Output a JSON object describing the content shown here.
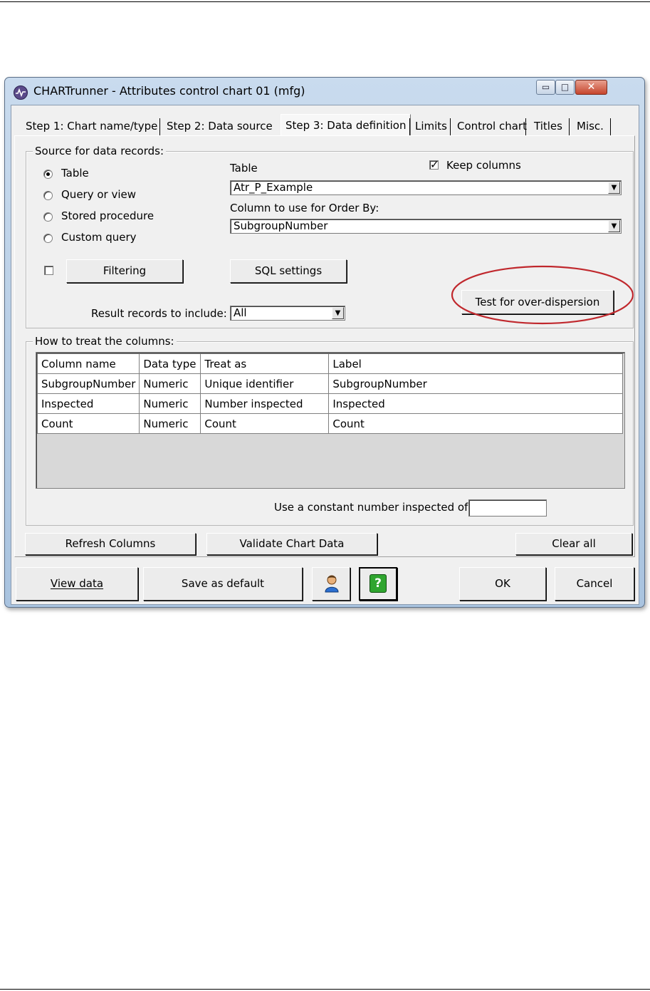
{
  "window": {
    "title": "CHARTrunner - Attributes control chart 01 (mfg)",
    "controls": {
      "minimize": "▭",
      "maximize": "□",
      "close": "✕"
    }
  },
  "tabs": [
    {
      "label": "Step 1: Chart name/type"
    },
    {
      "label": "Step 2: Data source"
    },
    {
      "label": "Step 3: Data definition",
      "active": true
    },
    {
      "label": "Limits"
    },
    {
      "label": "Control chart"
    },
    {
      "label": "Titles"
    },
    {
      "label": "Misc."
    }
  ],
  "source": {
    "group_label": "Source for data records:",
    "options": [
      {
        "label": "Table",
        "selected": true
      },
      {
        "label": "Query or view",
        "selected": false
      },
      {
        "label": "Stored procedure",
        "selected": false
      },
      {
        "label": "Custom query",
        "selected": false
      }
    ],
    "table_label": "Table",
    "table_value": "Atr_P_Example",
    "keep_columns_label": "Keep columns",
    "keep_columns_checked": true,
    "order_by_label": "Column to use for Order By:",
    "order_by_value": "SubgroupNumber",
    "filtering_checked": false,
    "filtering_button": "Filtering",
    "sql_settings_button": "SQL settings",
    "test_button": "Test for over-dispersion",
    "result_label": "Result records to include:",
    "result_value": "All"
  },
  "columns": {
    "group_label": "How to treat the columns:",
    "headers": [
      "Column name",
      "Data type",
      "Treat as",
      "Label"
    ],
    "rows": [
      [
        "SubgroupNumber",
        "Numeric",
        "Unique identifier",
        "SubgroupNumber"
      ],
      [
        "Inspected",
        "Numeric",
        "Number inspected",
        "Inspected"
      ],
      [
        "Count",
        "Numeric",
        "Count",
        "Count"
      ]
    ],
    "constant_label": "Use a constant number inspected of:",
    "constant_value": ""
  },
  "actions": {
    "refresh": "Refresh Columns",
    "validate": "Validate Chart Data",
    "clear": "Clear all"
  },
  "footer": {
    "view_data": "View data",
    "save_default": "Save as default",
    "user_icon": "user-icon",
    "help_icon": "help-icon",
    "help_glyph": "?",
    "ok": "OK",
    "cancel": "Cancel"
  },
  "colors": {
    "highlight_ellipse": "#c0282d",
    "help_green": "#2fa52f"
  }
}
